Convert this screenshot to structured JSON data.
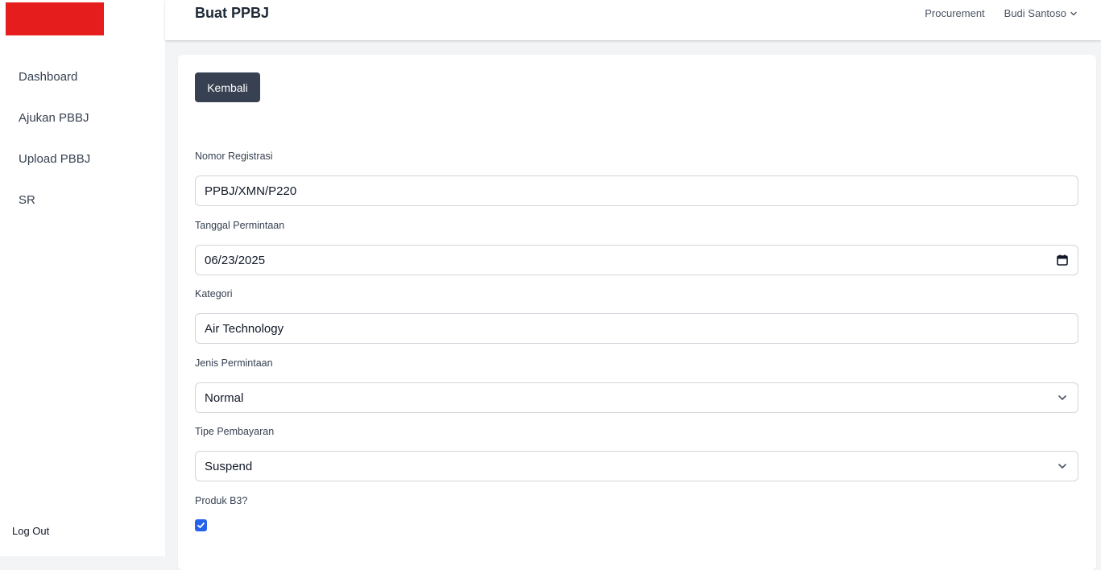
{
  "sidebar": {
    "items": [
      {
        "label": "Dashboard"
      },
      {
        "label": "Ajukan PBBJ"
      },
      {
        "label": "Upload PBBJ"
      },
      {
        "label": "SR"
      }
    ],
    "logout_label": "Log Out",
    "logo_color": "#e51d1d"
  },
  "header": {
    "title": "Buat PPBJ",
    "role": "Procurement",
    "user_name": "Budi Santoso"
  },
  "form": {
    "back_label": "Kembali",
    "nomor_registrasi": {
      "label": "Nomor Registrasi",
      "value": "PPBJ/XMN/P220"
    },
    "tanggal_permintaan": {
      "label": "Tanggal Permintaan",
      "value": "06/23/2025"
    },
    "kategori": {
      "label": "Kategori",
      "value": "Air Technology"
    },
    "jenis_permintaan": {
      "label": "Jenis Permintaan",
      "value": "Normal"
    },
    "tipe_pembayaran": {
      "label": "Tipe Pembayaran",
      "value": "Suspend"
    },
    "produk_b3": {
      "label": "Produk B3?",
      "checked": true
    }
  },
  "colors": {
    "accent": "#2563eb",
    "button_dark": "#374151"
  },
  "icons": {
    "calendar": "calendar-icon",
    "select_chevron": "chevron-down-icon",
    "checkbox": "checkmark-icon"
  }
}
